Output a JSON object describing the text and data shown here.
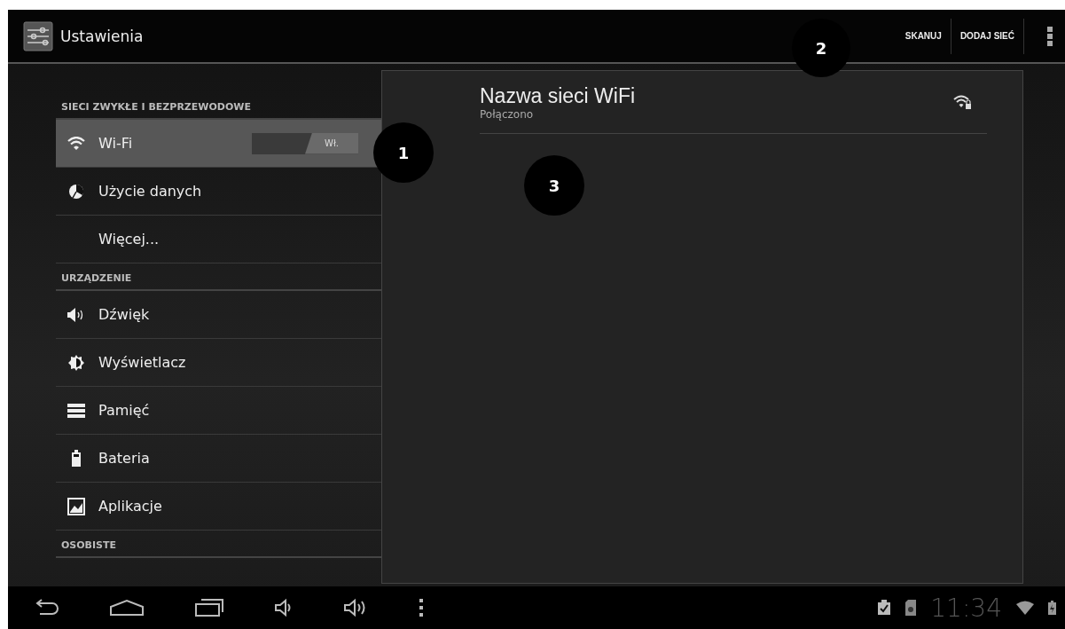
{
  "action_bar": {
    "title": "Ustawienia",
    "actions": [
      {
        "label": "SKANUJ"
      },
      {
        "label": "DODAJ SIEĆ"
      }
    ]
  },
  "sidebar": {
    "sections": [
      {
        "header": "SIECI ZWYKŁE I BEZPRZEWODOWE",
        "items": [
          {
            "label": "Wi-Fi",
            "selected": true,
            "switch": {
              "label": "Wł.",
              "on": true
            }
          },
          {
            "label": "Użycie danych",
            "selected": false
          },
          {
            "label": "Więcej...",
            "selected": false
          }
        ]
      },
      {
        "header": "URZĄDZENIE",
        "items": [
          {
            "label": "Dźwięk",
            "selected": false
          },
          {
            "label": "Wyświetlacz",
            "selected": false
          },
          {
            "label": "Pamięć",
            "selected": false
          },
          {
            "label": "Bateria",
            "selected": false
          },
          {
            "label": "Aplikacje",
            "selected": false
          }
        ]
      },
      {
        "header": "OSOBISTE"
      }
    ]
  },
  "networks": [
    {
      "name": "Nazwa sieci WiFi",
      "status": "Połączono"
    }
  ],
  "callouts": [
    {
      "label": "1"
    },
    {
      "label": "2"
    },
    {
      "label": "3"
    }
  ],
  "status_bar": {
    "time": "11:34"
  }
}
